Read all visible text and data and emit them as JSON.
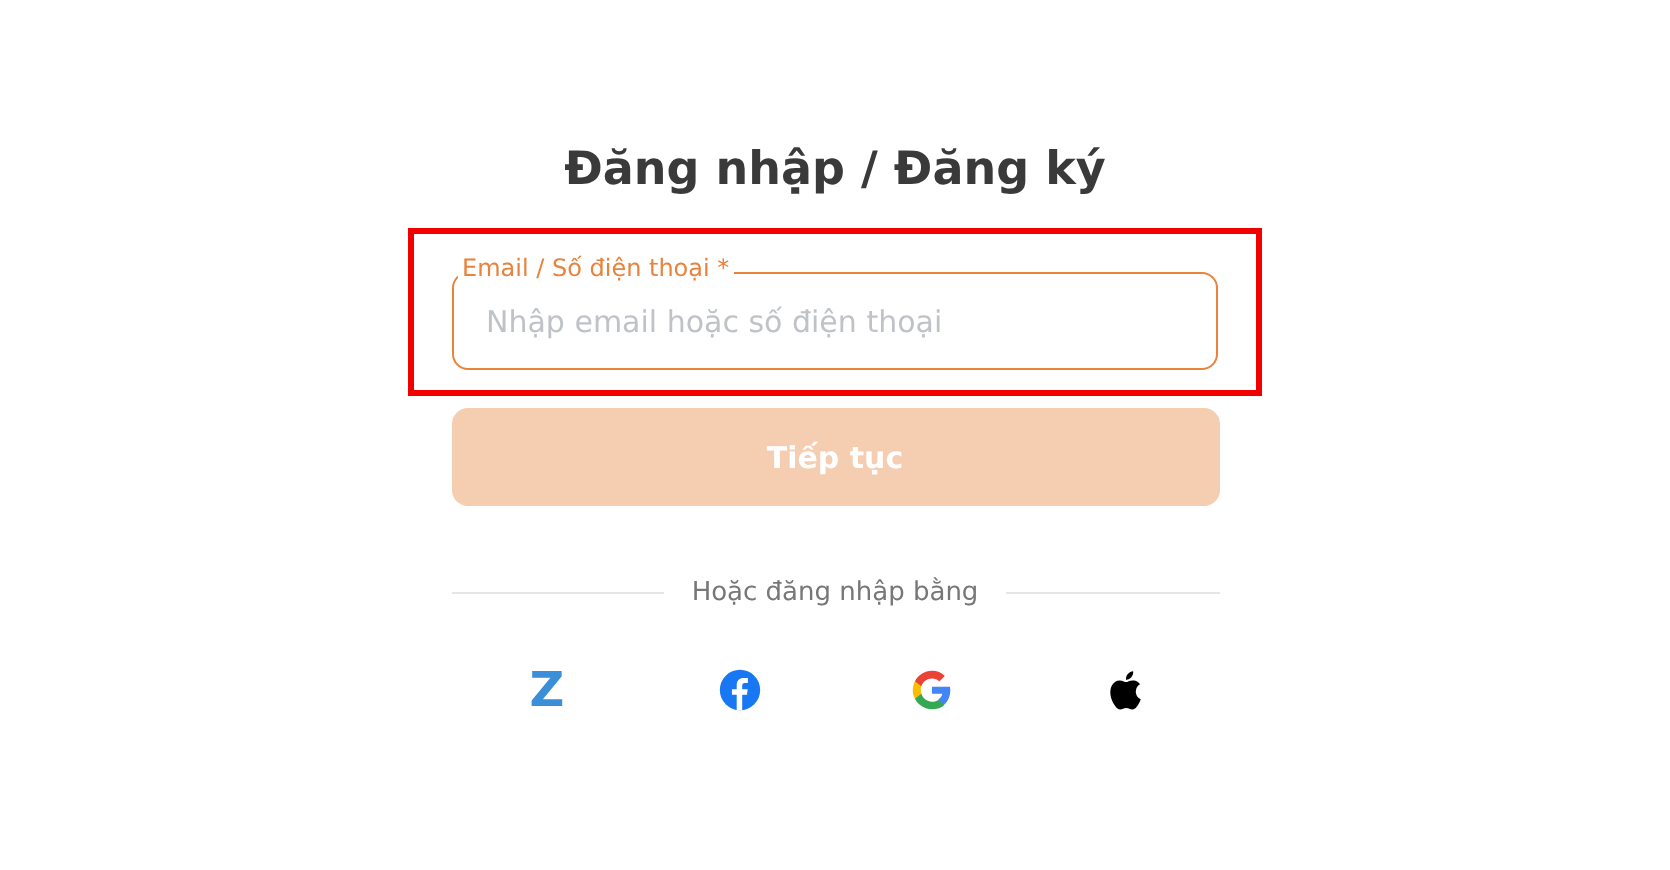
{
  "title": "Đăng nhập / Đăng ký",
  "highlight": {
    "shown": true
  },
  "field": {
    "label": "Email / Số điện thoại *",
    "placeholder": "Nhập email hoặc số điện thoại",
    "focused": true
  },
  "submit": {
    "label": "Tiếp tục",
    "disabled": true
  },
  "divider_text": "Hoặc đăng nhập bằng",
  "providers": [
    {
      "kind": "zalo",
      "glyph": "Z"
    },
    {
      "kind": "facebook"
    },
    {
      "kind": "google"
    },
    {
      "kind": "apple"
    }
  ]
}
